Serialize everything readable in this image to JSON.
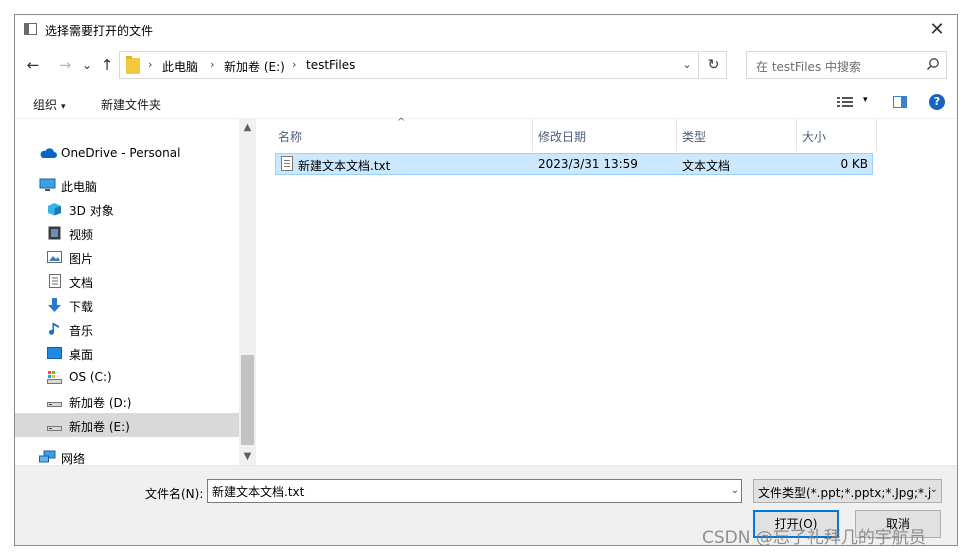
{
  "window": {
    "title": "选择需要打开的文件",
    "close_glyph": "✕"
  },
  "nav_buttons": {
    "back": "←",
    "forward": "→",
    "recent": "⌄",
    "up": "↑"
  },
  "address": {
    "breadcrumbs": [
      "此电脑",
      "新加卷 (E:)",
      "testFiles"
    ],
    "separator": "›",
    "dropdown_glyph": "⌄",
    "refresh_glyph": "↻"
  },
  "search": {
    "placeholder": "在 testFiles 中搜索"
  },
  "toolbar": {
    "organize_label": "组织",
    "organize_caret": "▾",
    "new_folder_label": "新建文件夹",
    "view_caret": "▾",
    "help_glyph": "?"
  },
  "navpane": {
    "items": [
      {
        "label": "OneDrive - Personal",
        "icon": "cloud-icon"
      },
      {
        "label": "此电脑",
        "icon": "computer-icon"
      },
      {
        "label": "3D 对象",
        "icon": "cube-3d-icon"
      },
      {
        "label": "视频",
        "icon": "video-icon"
      },
      {
        "label": "图片",
        "icon": "pictures-icon"
      },
      {
        "label": "文档",
        "icon": "documents-icon"
      },
      {
        "label": "下载",
        "icon": "download-icon"
      },
      {
        "label": "音乐",
        "icon": "music-icon"
      },
      {
        "label": "桌面",
        "icon": "desktop-icon"
      },
      {
        "label": "OS (C:)",
        "icon": "os-drive-icon"
      },
      {
        "label": "新加卷 (D:)",
        "icon": "drive-icon"
      },
      {
        "label": "新加卷 (E:)",
        "icon": "drive-icon",
        "selected": true
      },
      {
        "label": "网络",
        "icon": "network-icon"
      }
    ],
    "scroll_up_glyph": "▲",
    "scroll_down_glyph": "▼"
  },
  "filelist": {
    "columns": [
      "名称",
      "修改日期",
      "类型",
      "大小"
    ],
    "sort_caret": "^",
    "rows": [
      {
        "name": "新建文本文档.txt",
        "modified": "2023/3/31 13:59",
        "type": "文本文档",
        "size": "0 KB"
      }
    ]
  },
  "footer": {
    "filename_label": "文件名(N):",
    "filename_value": "新建文本文档.txt",
    "filename_dropdown_glyph": "⌄",
    "filetype_value": "文件类型(*.ppt;*.pptx;*.Jpg;*.j",
    "filetype_dropdown_glyph": "⌄",
    "open_label": "打开(O)",
    "cancel_label": "取消"
  },
  "watermark": "CSDN @忘了礼拜几的宇航员",
  "colors": {
    "accent": "#0078d7",
    "selection": "#cce8ff",
    "selection_border": "#99d1ff",
    "help": "#1565c0"
  }
}
